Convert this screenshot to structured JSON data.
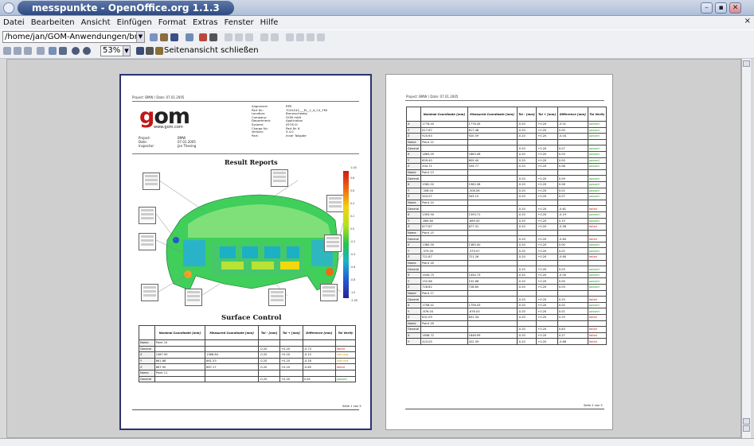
{
  "window": {
    "title": "messpunkte - OpenOffice.org 1.1.3",
    "min_label": "–",
    "max_label": "▪",
    "close_label": "✕"
  },
  "menu": [
    "Datei",
    "Bearbeiten",
    "Ansicht",
    "Einfügen",
    "Format",
    "Extras",
    "Fenster",
    "Hilfe"
  ],
  "menu_close": "×",
  "toolbar": {
    "path_value": "/home/jan/GOM-Anwendungen/bmwmo",
    "zoom_value": "53%",
    "close_preview_label": "Seitenansicht schließen"
  },
  "page1": {
    "header_left": "Project: BMW / Date: 07.01.2005",
    "logo_text": "om",
    "logo_g": "g",
    "logo_url": "www.gom.com",
    "proj_labels": "Project:\nDate:\nInspector:",
    "proj_values": "BMW\n07.01.2005\nJan Thesing",
    "meta_labels": "Alignment:\nPart Nr.:\nLocation:\nCompany:\nDepartment:\nSystem:\nCharge Nr.:\nVersion:\nPart:",
    "meta_values": "RPS\n7024242___M__1_A_C4_FMI\nBraunschweig\nGOM mbH\nApplication\nATOS III\nPart Nr. 6\n5.4.0\nInner Tailgate",
    "title_result": "Result Reports",
    "title_surface": "Surface Control",
    "scale_top": "1.00",
    "scale_ticks": [
      "0.8",
      "0.6",
      "0.4",
      "0.2",
      "0.0",
      "-0.2",
      "-0.4",
      "-0.6",
      "-0.8",
      "-1.0"
    ],
    "scale_bottom": "-1.00",
    "columns": [
      "",
      "Nominal Coordinate [mm]",
      "Measured Coordinate [mm]",
      "Tol - [mm]",
      "Tol + [mm]",
      "Difference [mm]",
      "Tol Verify"
    ],
    "rows": [
      [
        "Name",
        "Point 10",
        "",
        "",
        "",
        "",
        ""
      ],
      [
        "General",
        "",
        "",
        "-0.20",
        "+0.20",
        "-0.73",
        "failed"
      ],
      [
        "X",
        "1367.90",
        "1366.84",
        "-0.20",
        "+0.20",
        "-0.15",
        "warning"
      ],
      [
        "Y",
        "661.68",
        "661.53",
        "-0.20",
        "+0.20",
        "-0.18",
        "warning"
      ],
      [
        "Z",
        "667.90",
        "667.17",
        "-0.20",
        "+0.20",
        "-0.60",
        "failed"
      ],
      [
        "Name",
        "Point 11",
        "",
        "",
        "",
        "",
        ""
      ],
      [
        "General",
        "",
        "",
        "-0.20",
        "+0.20",
        "0.04",
        "passed"
      ]
    ],
    "footer": "Seite 1 von 5"
  },
  "page2": {
    "header_left": "Project: BMW / Date: 07.01.2005",
    "columns": [
      "",
      "Nominal Coordinate [mm]",
      "Measured Coordinate [mm]",
      "Tol - [mm]",
      "Tol + [mm]",
      "Difference [mm]",
      "Tol Verify"
    ],
    "rows": [
      [
        "X",
        "1776.45",
        "1776.45",
        "-0.20",
        "+0.20",
        "-0.01",
        "passed"
      ],
      [
        "Y",
        "617.67",
        "617.48",
        "-0.20",
        "+0.20",
        "0.00",
        "passed"
      ],
      [
        "Z",
        "920.63",
        "920.59",
        "-0.20",
        "+0.20",
        "-0.04",
        "passed"
      ],
      [
        "Name",
        "Point 12",
        "",
        "",
        "",
        "",
        ""
      ],
      [
        "General",
        "",
        "",
        "-0.20",
        "+0.20",
        "0.07",
        "passed"
      ],
      [
        "X",
        "1863.05",
        "1863.08",
        "-0.20",
        "+0.20",
        "0.03",
        "passed"
      ],
      [
        "Y",
        "609.40",
        "609.40",
        "-0.20",
        "+0.20",
        "0.00",
        "passed"
      ],
      [
        "Z",
        "334.71",
        "334.77",
        "-0.20",
        "+0.20",
        "0.06",
        "passed"
      ],
      [
        "Name",
        "Point 13",
        "",
        "",
        "",
        "",
        ""
      ],
      [
        "General",
        "",
        "",
        "-0.20",
        "+0.20",
        "0.09",
        "passed"
      ],
      [
        "X",
        "1962.02",
        "1962.08",
        "-0.20",
        "+0.20",
        "0.06",
        "passed"
      ],
      [
        "Y",
        "-308.04",
        "-308.06",
        "-0.20",
        "+0.20",
        "0.01",
        "passed"
      ],
      [
        "Z",
        "343.07",
        "343.15",
        "-0.20",
        "+0.20",
        "0.07",
        "passed"
      ],
      [
        "Name",
        "Point 14",
        "",
        "",
        "",
        "",
        ""
      ],
      [
        "General",
        "",
        "",
        "-0.20",
        "+0.20",
        "-0.61",
        "failed"
      ],
      [
        "X",
        "1393.90",
        "1393.71",
        "-0.20",
        "+0.20",
        "-0.19",
        "passed"
      ],
      [
        "Y",
        "-669.60",
        "-669.45",
        "-0.20",
        "+0.20",
        "0.15",
        "passed"
      ],
      [
        "Z",
        "677.87",
        "677.31",
        "-0.20",
        "+0.20",
        "-0.56",
        "failed"
      ],
      [
        "Name",
        "Point 15",
        "",
        "",
        "",
        "",
        ""
      ],
      [
        "General",
        "",
        "",
        "-0.20",
        "+0.20",
        "-0.60",
        "failed"
      ],
      [
        "X",
        "1385.00",
        "1385.00",
        "-0.20",
        "+0.20",
        "0.00",
        "passed"
      ],
      [
        "Y",
        "-379.09",
        "-379.07",
        "-0.20",
        "+0.20",
        "0.02",
        "passed"
      ],
      [
        "Z",
        "721.87",
        "721.26",
        "-0.20",
        "+0.20",
        "-0.60",
        "failed"
      ],
      [
        "Name",
        "Point 16",
        "",
        "",
        "",
        "",
        ""
      ],
      [
        "General",
        "",
        "",
        "-0.20",
        "+0.20",
        "0.03",
        "passed"
      ],
      [
        "X",
        "1444.75",
        "1444.73",
        "-0.20",
        "+0.20",
        "-0.00",
        "passed"
      ],
      [
        "Y",
        "152.66",
        "152.66",
        "-0.20",
        "+0.20",
        "0.00",
        "passed"
      ],
      [
        "Z",
        "728.82",
        "728.85",
        "-0.20",
        "+0.20",
        "0.03",
        "passed"
      ],
      [
        "Name",
        "Point 17",
        "",
        "",
        "",
        "",
        ""
      ],
      [
        "General",
        "",
        "",
        "-0.20",
        "+0.20",
        "0.25",
        "failed"
      ],
      [
        "X",
        "1758.41",
        "1758.43",
        "-0.20",
        "+0.20",
        "0.02",
        "passed"
      ],
      [
        "Y",
        "-676.04",
        "-676.03",
        "-0.20",
        "+0.20",
        "0.01",
        "passed"
      ],
      [
        "Z",
        "831.09",
        "831.34",
        "-0.20",
        "+0.20",
        "0.25",
        "failed"
      ],
      [
        "Name",
        "Point 18",
        "",
        "",
        "",
        "",
        ""
      ],
      [
        "General",
        "",
        "",
        "-0.20",
        "+0.20",
        "0.83",
        "failed"
      ],
      [
        "X",
        "1846.72",
        "1846.99",
        "-0.20",
        "+0.20",
        "0.27",
        "failed"
      ],
      [
        "Y",
        "423.05",
        "422.39",
        "-0.20",
        "+0.20",
        "-0.66",
        "failed"
      ]
    ],
    "footer": "Seite 2 von 5"
  },
  "colors": {
    "page1_border": "#2a3373",
    "failed": "#d01010",
    "passed": "#1c9c1c",
    "warning": "#c89a00"
  }
}
